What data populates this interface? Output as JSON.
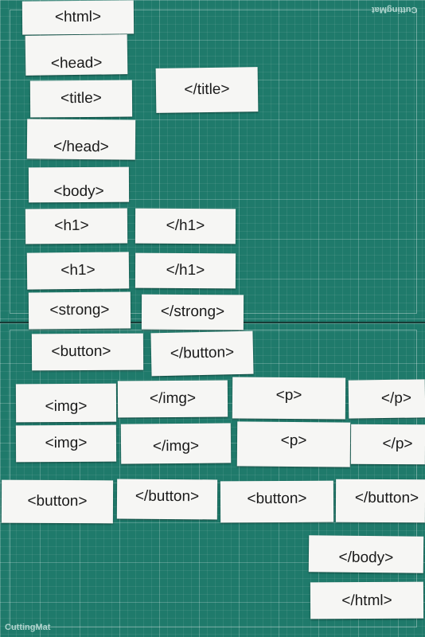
{
  "mat": {
    "brand_top": "CuttingMat",
    "brand_bottom": "CuttingMat"
  },
  "tags": [
    "<html>",
    "<head>",
    "<title>",
    "</title>",
    "</head>",
    "<body>",
    "<h1>",
    "</h1>",
    "<h1>",
    "</h1>",
    "<strong>",
    "</strong>",
    "<button>",
    "</button>",
    "<img>",
    "</img>",
    "<p>",
    "</p>",
    "<img>",
    "</img>",
    "<p>",
    "</p>",
    "<button>",
    "</button>",
    "<button>",
    "</button>",
    "</body>",
    "</html>"
  ],
  "colors": {
    "mat": "#1f7a6b",
    "paper": "#f6f6f4"
  }
}
